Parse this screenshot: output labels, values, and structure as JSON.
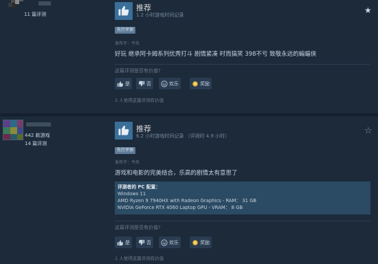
{
  "reviews": [
    {
      "author": {
        "reviews_count": "11 篇评测"
      },
      "verdict": "推荐",
      "hours": "1.2 小时游戏时间记录",
      "tag": "先行评测",
      "posted": "发布于：今天",
      "text": "好玩 继承阿卡姆系列优秀打斗 剧情紧凑 时而搞笑 398不亏 致敬永远的蝙蝠侠",
      "helpful_question": "这篇评测是否有价值?",
      "buttons": {
        "yes": "是",
        "no": "否",
        "funny": "欢乐",
        "award": "奖励"
      },
      "found_helpful": "2 人觉得这篇评测有价值"
    },
    {
      "author": {
        "games_count": "442 款游戏",
        "reviews_count": "14 篇评测"
      },
      "verdict": "推荐",
      "hours": "6.2 小时游戏时间记录 （评测时 4.9 小时）",
      "tag": "先行评测",
      "posted": "发布于：今天",
      "text": "游戏和电影的完美结合，乐高的剧情太有意思了",
      "specs": {
        "title": "评测者的 PC 配置：",
        "lines": [
          "Windows 11",
          "AMD Ryzen 9 7940HX with Radeon Graphics - RAM： 31 GB",
          "NVIDIA GeForce RTX 4060 Laptop GPU - VRAM： 8 GB"
        ]
      },
      "helpful_question": "这篇评测是否有价值?",
      "buttons": {
        "yes": "是",
        "no": "否",
        "funny": "欢乐",
        "award": "奖励"
      },
      "found_helpful": "1 人觉得这篇评测有价值"
    }
  ],
  "colors": {
    "background": "#1b2838",
    "thumb_badge": "#3a6f99",
    "tag": "#5d7b98",
    "specs_box": "#2b4a63"
  },
  "icons": [
    "thumbs-up-icon",
    "star-icon",
    "thumbs-down-icon",
    "smiley-icon",
    "award-icon"
  ]
}
